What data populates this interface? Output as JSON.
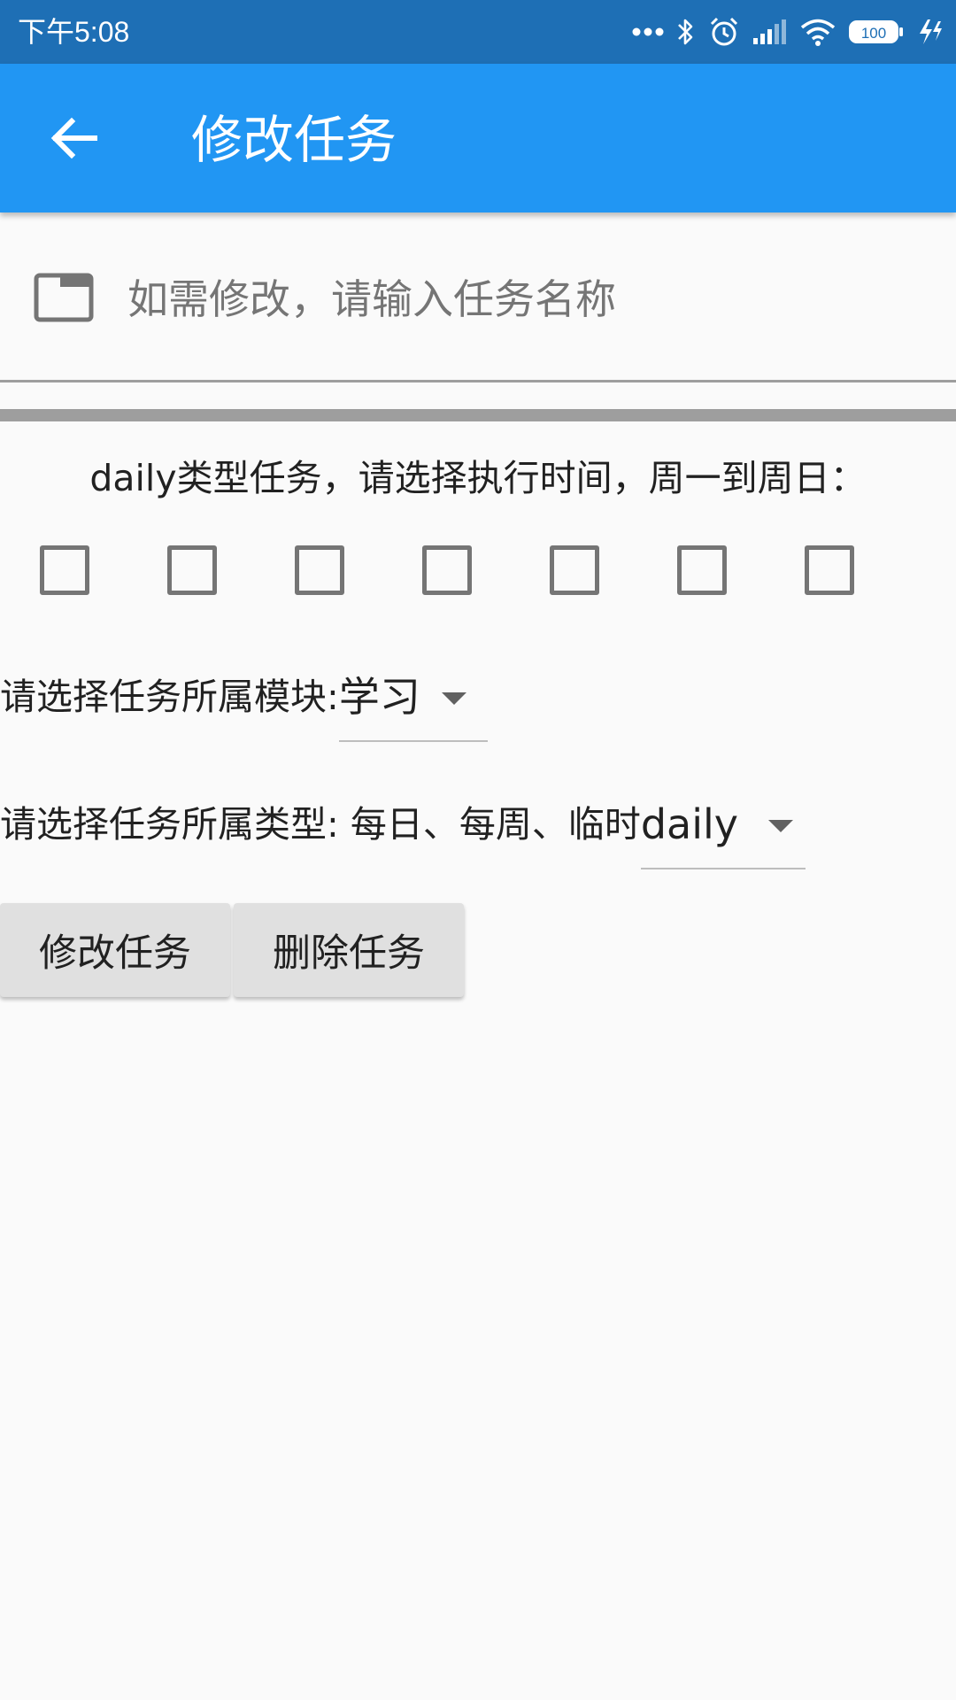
{
  "status_bar": {
    "time": "下午5:08",
    "battery": "100",
    "icons": [
      "more-dots-icon",
      "bluetooth-icon",
      "alarm-icon",
      "signal-icon",
      "wifi-icon",
      "battery-icon",
      "charging-icon"
    ]
  },
  "app_bar": {
    "title": "修改任务",
    "back_icon": "arrow-left-icon",
    "color": "#2196f3"
  },
  "task_name": {
    "placeholder": "如需修改，请输入任务名称",
    "value": "",
    "icon": "folder-icon"
  },
  "daily": {
    "prompt": "daily类型任务，请选择执行时间，周一到周日：",
    "days_checked": [
      false,
      false,
      false,
      false,
      false,
      false,
      false
    ]
  },
  "module": {
    "label": "请选择任务所属模块:",
    "selected": "学习"
  },
  "type": {
    "label": "请选择任务所属类型: 每日、每周、临时",
    "selected": "daily"
  },
  "buttons": {
    "modify": "修改任务",
    "delete": "删除任务"
  }
}
